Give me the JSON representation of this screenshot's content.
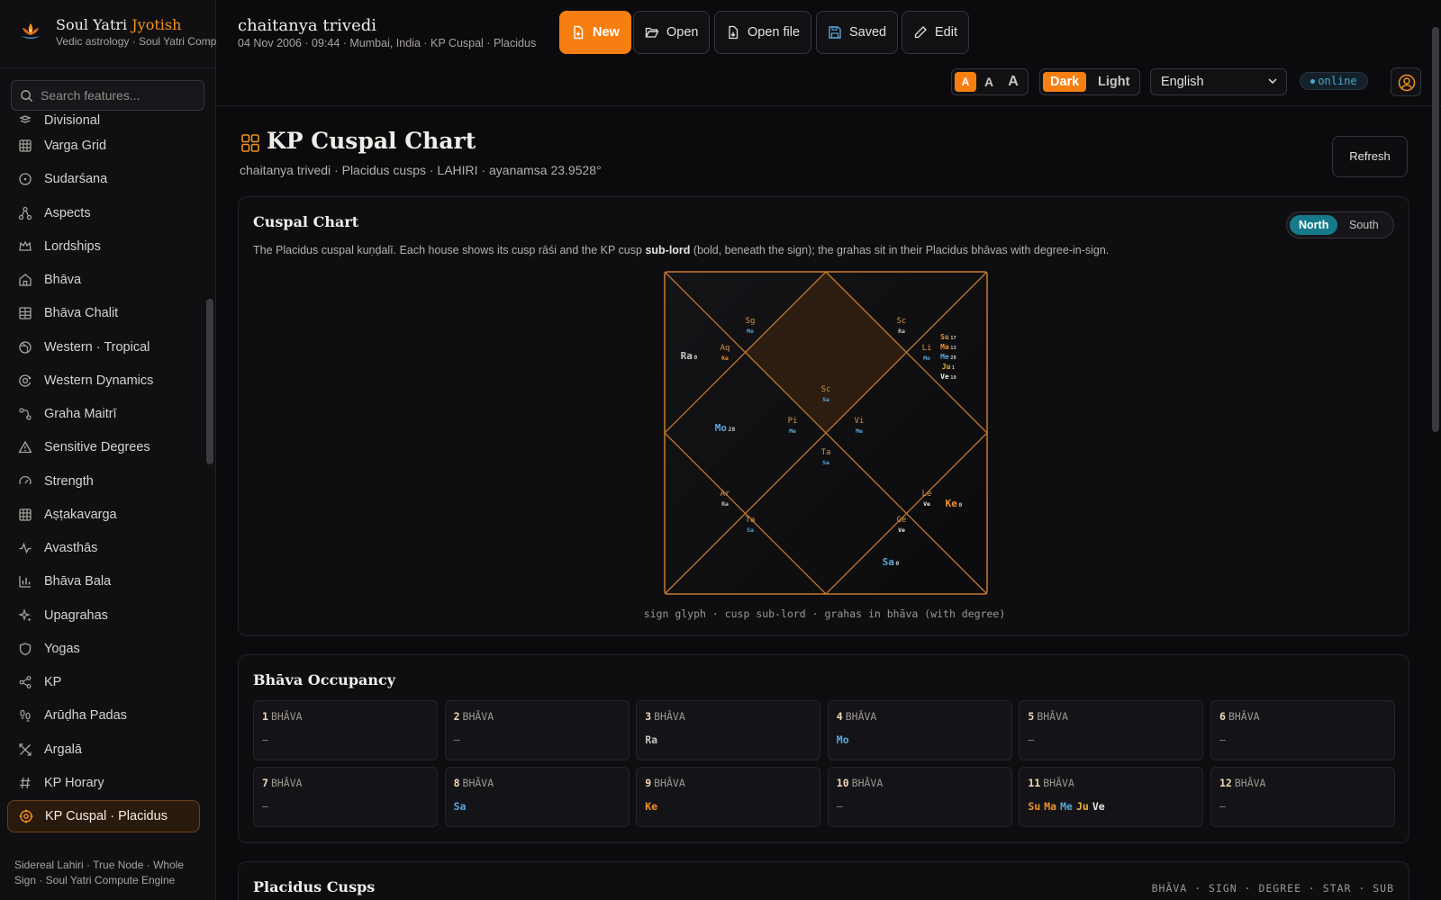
{
  "brand": {
    "name": "Soul Yatri",
    "name_accent": "Jyotish",
    "tagline": "Vedic astrology · Soul Yatri Compute Engine"
  },
  "search": {
    "placeholder": "Search features..."
  },
  "sidebar": {
    "items": [
      {
        "label": "Divisional",
        "icon": "divisional-icon"
      },
      {
        "label": "Varga Grid",
        "icon": "grid-icon"
      },
      {
        "label": "Sudarśana",
        "icon": "circle-dot-icon"
      },
      {
        "label": "Aspects",
        "icon": "network-icon"
      },
      {
        "label": "Lordships",
        "icon": "crown-icon"
      },
      {
        "label": "Bhāva",
        "icon": "home-icon"
      },
      {
        "label": "Bhāva Chalit",
        "icon": "table-icon"
      },
      {
        "label": "Western · Tropical",
        "icon": "globe-icon"
      },
      {
        "label": "Western Dynamics",
        "icon": "orbit-icon"
      },
      {
        "label": "Graha Maitrī",
        "icon": "link-icon"
      },
      {
        "label": "Sensitive Degrees",
        "icon": "warning-icon"
      },
      {
        "label": "Strength",
        "icon": "gauge-icon"
      },
      {
        "label": "Aṣṭakavarga",
        "icon": "grid-icon"
      },
      {
        "label": "Avasthās",
        "icon": "activity-icon"
      },
      {
        "label": "Bhāva Bala",
        "icon": "bar-chart-icon"
      },
      {
        "label": "Upagrahas",
        "icon": "sparkle-icon"
      },
      {
        "label": "Yogas",
        "icon": "shield-icon"
      },
      {
        "label": "KP",
        "icon": "share-icon"
      },
      {
        "label": "Arūḍha Padas",
        "icon": "footprints-icon"
      },
      {
        "label": "Argalā",
        "icon": "cross-icon"
      },
      {
        "label": "KP Horary",
        "icon": "hash-icon"
      },
      {
        "label": "KP Cuspal · Placidus",
        "icon": "target-icon",
        "active": true
      }
    ],
    "footer": "Sidereal Lahiri · True Node · Whole Sign · Soul Yatri Compute Engine"
  },
  "header": {
    "name": "chaitanya trivedi",
    "meta": "04 Nov 2006 · 09:44 · Mumbai, India  ·  KP Cuspal · Placidus",
    "buttons": {
      "new": "New",
      "open": "Open",
      "open_file": "Open file",
      "saved": "Saved",
      "edit": "Edit"
    },
    "font_sizes": [
      "A",
      "A",
      "A"
    ],
    "theme": {
      "dark": "Dark",
      "light": "Light",
      "selected": "Dark"
    },
    "language": "English",
    "status": "online"
  },
  "page": {
    "title": "KP Cuspal Chart",
    "subtitle": "chaitanya trivedi · Placidus cusps · LAHIRI · ayanamsa 23.9528°",
    "refresh": "Refresh"
  },
  "cuspal": {
    "title": "Cuspal Chart",
    "desc_before": "The Placidus cuspal kuṇḍalī. Each house shows its cusp rāśi and the KP cusp ",
    "desc_bold": "sub-lord",
    "desc_after": " (bold, beneath the sign); the grahas sit in their Placidus bhāvas with degree-in-sign.",
    "toggle": {
      "north": "North",
      "south": "South",
      "selected": "North"
    },
    "caption": "sign glyph · cusp sub-lord · grahas in bhāva (with degree)",
    "houses": [
      {
        "house": 1,
        "sign": "Sc",
        "sub": "Sa"
      },
      {
        "house": 2,
        "sign": "Sg",
        "sub": "Mo"
      },
      {
        "house": 3,
        "sign": "Aq",
        "sub": "Ke"
      },
      {
        "house": 4,
        "sign": "Pi",
        "sub": "Me"
      },
      {
        "house": 5,
        "sign": "Ar",
        "sub": "Ra"
      },
      {
        "house": 6,
        "sign": "Ta",
        "sub": "Sa"
      },
      {
        "house": 7,
        "sign": "Ta",
        "sub": "Sa"
      },
      {
        "house": 8,
        "sign": "Ge",
        "sub": "Ve"
      },
      {
        "house": 9,
        "sign": "Le",
        "sub": "Ve"
      },
      {
        "house": 10,
        "sign": "Vi",
        "sub": "Me"
      },
      {
        "house": 11,
        "sign": "Li",
        "sub": "Mo"
      },
      {
        "house": 12,
        "sign": "Sc",
        "sub": "Ra"
      }
    ],
    "planets": [
      {
        "graha": "Ra",
        "deg": "0",
        "house": 3
      },
      {
        "graha": "Mo",
        "deg": "28",
        "house": 4
      },
      {
        "graha": "Sa",
        "deg": "0",
        "house": 8
      },
      {
        "graha": "Ke",
        "deg": "0",
        "house": 9
      },
      {
        "graha": "Su",
        "deg": "17",
        "house": 11
      },
      {
        "graha": "Ma",
        "deg": "13",
        "house": 11
      },
      {
        "graha": "Me",
        "deg": "28",
        "house": 11
      },
      {
        "graha": "Ju",
        "deg": "1",
        "house": 11
      },
      {
        "graha": "Ve",
        "deg": "10",
        "house": 11
      }
    ]
  },
  "occupancy": {
    "title": "Bhāva Occupancy",
    "label": "BHĀVA",
    "cells": [
      {
        "n": "1",
        "grahas": []
      },
      {
        "n": "2",
        "grahas": []
      },
      {
        "n": "3",
        "grahas": [
          "Ra"
        ]
      },
      {
        "n": "4",
        "grahas": [
          "Mo"
        ]
      },
      {
        "n": "5",
        "grahas": []
      },
      {
        "n": "6",
        "grahas": []
      },
      {
        "n": "7",
        "grahas": []
      },
      {
        "n": "8",
        "grahas": [
          "Sa"
        ]
      },
      {
        "n": "9",
        "grahas": [
          "Ke"
        ]
      },
      {
        "n": "10",
        "grahas": []
      },
      {
        "n": "11",
        "grahas": [
          "Su",
          "Ma",
          "Me",
          "Ju",
          "Ve"
        ]
      },
      {
        "n": "12",
        "grahas": []
      }
    ],
    "empty": "—"
  },
  "cusps": {
    "title": "Placidus Cusps",
    "legend": "BHĀVA · SIGN · DEGREE · STAR · SUB"
  },
  "colors": {
    "accent": "#f77f12",
    "chart_line": "#c67a2e",
    "graha_colors": {
      "Su": "#f0902c",
      "Ma": "#f0902c",
      "Me": "#5aa6d9",
      "Ju": "#e8b33b",
      "Ve": "#e8e3dc",
      "Mo": "#5aa6d9",
      "Sa": "#5aa6d9",
      "Ra": "#c9c5bf",
      "Ke": "#f0902c"
    }
  }
}
